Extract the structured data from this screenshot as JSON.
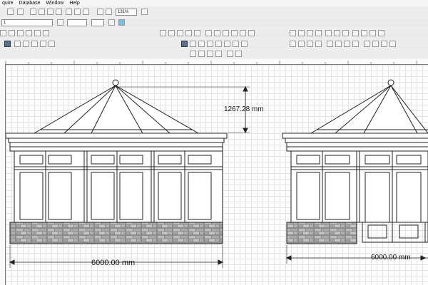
{
  "menu": {
    "items": [
      "quire",
      "Database",
      "Window",
      "Help"
    ]
  },
  "toolbar": {
    "zoom_value": "131%",
    "line_weight_value": "1"
  },
  "drawing": {
    "left_roof_dimension": "1267.28 mm",
    "left_width_dimension": "6000.00 mm",
    "right_width_dimension": "6000.00 mm"
  },
  "colors": {
    "stone": "#7a7a7a",
    "line": "#222222",
    "grid": "#e3e3e3"
  }
}
